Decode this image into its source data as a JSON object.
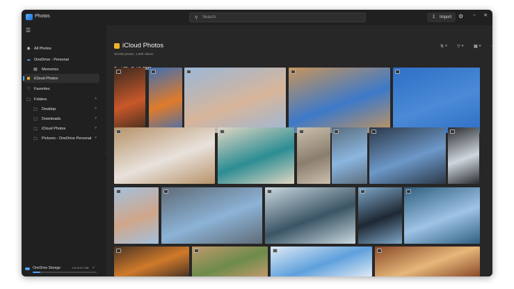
{
  "titlebar": {
    "app_title": "Photos",
    "search_placeholder": "Search",
    "import_label": "Import",
    "icons": [
      "photos-app-icon",
      "search-icon",
      "import-icon",
      "gear-icon",
      "minimize-icon",
      "maximize-icon",
      "close-icon"
    ]
  },
  "sidebar": {
    "items": [
      {
        "label": "All Photos",
        "icon": "all-photos-icon"
      },
      {
        "label": "OneDrive - Personal",
        "icon": "cloud-icon"
      },
      {
        "label": "Memories",
        "icon": "memories-icon"
      },
      {
        "label": "iCloud Photos",
        "icon": "icloud-icon"
      },
      {
        "label": "Favorites",
        "icon": "heart-icon"
      },
      {
        "label": "Folders",
        "icon": "folder-icon"
      },
      {
        "label": "Desktop",
        "icon": "folder-icon"
      },
      {
        "label": "Downloads",
        "icon": "folder-icon"
      },
      {
        "label": "iCloud Photos",
        "icon": "folder-icon"
      },
      {
        "label": "Pictures - OneDrive Personal",
        "icon": "folder-icon"
      }
    ],
    "storage": {
      "label": "OneDrive Storage",
      "amount": "0.6 of 5.0 GB",
      "used_fraction": 0.12
    }
  },
  "main": {
    "title": "iCloud Photos",
    "subtitle": "40,635 photos, 1,999 videos",
    "date_header": "Sept 25 - Oct 3, 2022",
    "toolbar_icons": [
      "sort-icon",
      "filter-icon",
      "view-icon",
      "more-icon"
    ]
  },
  "photos": [
    {
      "subject": "food-bowls",
      "colors": [
        "#c9582a",
        "#3a2a1e"
      ]
    },
    {
      "subject": "orange-wall-shadow",
      "colors": [
        "#e07b2a",
        "#3f6fb3"
      ]
    },
    {
      "subject": "desert-rock-hiker",
      "colors": [
        "#d8b59a",
        "#9ab8d8"
      ]
    },
    {
      "subject": "joshua-trees",
      "colors": [
        "#3d79c9",
        "#c7955a"
      ]
    },
    {
      "subject": "tower-with-birds",
      "colors": [
        "#4a8ad6",
        "#2f6fc6"
      ]
    },
    {
      "subject": "dog-on-chair",
      "colors": [
        "#e8e2dc",
        "#b8936a"
      ]
    },
    {
      "subject": "pizza-and-coffee",
      "colors": [
        "#2c8d93",
        "#e1d6c4"
      ]
    },
    {
      "subject": "dog-on-beach",
      "colors": [
        "#8a7e6e",
        "#cbbfae"
      ]
    },
    {
      "subject": "bikes-by-water",
      "colors": [
        "#8bb6df",
        "#5a6d7e"
      ]
    },
    {
      "subject": "eiffel-under",
      "colors": [
        "#6d98c9",
        "#2b3848"
      ]
    },
    {
      "subject": "glass-arches",
      "colors": [
        "#cfd6dd",
        "#2a2d31"
      ]
    },
    {
      "subject": "desert-canyon",
      "colors": [
        "#d0a68a",
        "#a3c1dd"
      ]
    },
    {
      "subject": "city-mountains",
      "colors": [
        "#8cb3d6",
        "#5f6b77"
      ]
    },
    {
      "subject": "forest-sunlight",
      "colors": [
        "#3b5565",
        "#c9d8df"
      ]
    },
    {
      "subject": "rocky-coast",
      "colors": [
        "#1e2833",
        "#7ea6c7"
      ]
    },
    {
      "subject": "lake-shore",
      "colors": [
        "#9ec3e5",
        "#2f5f80"
      ]
    },
    {
      "subject": "breakfast-plate",
      "colors": [
        "#d07a2a",
        "#4b3424"
      ]
    },
    {
      "subject": "dog-in-grass",
      "colors": [
        "#6d8b4a",
        "#c09a6c"
      ]
    },
    {
      "subject": "sky-clouds",
      "colors": [
        "#5ea0dc",
        "#dfeaf5"
      ]
    },
    {
      "subject": "pastry-plate",
      "colors": [
        "#e6b77a",
        "#8a4a28"
      ]
    }
  ]
}
